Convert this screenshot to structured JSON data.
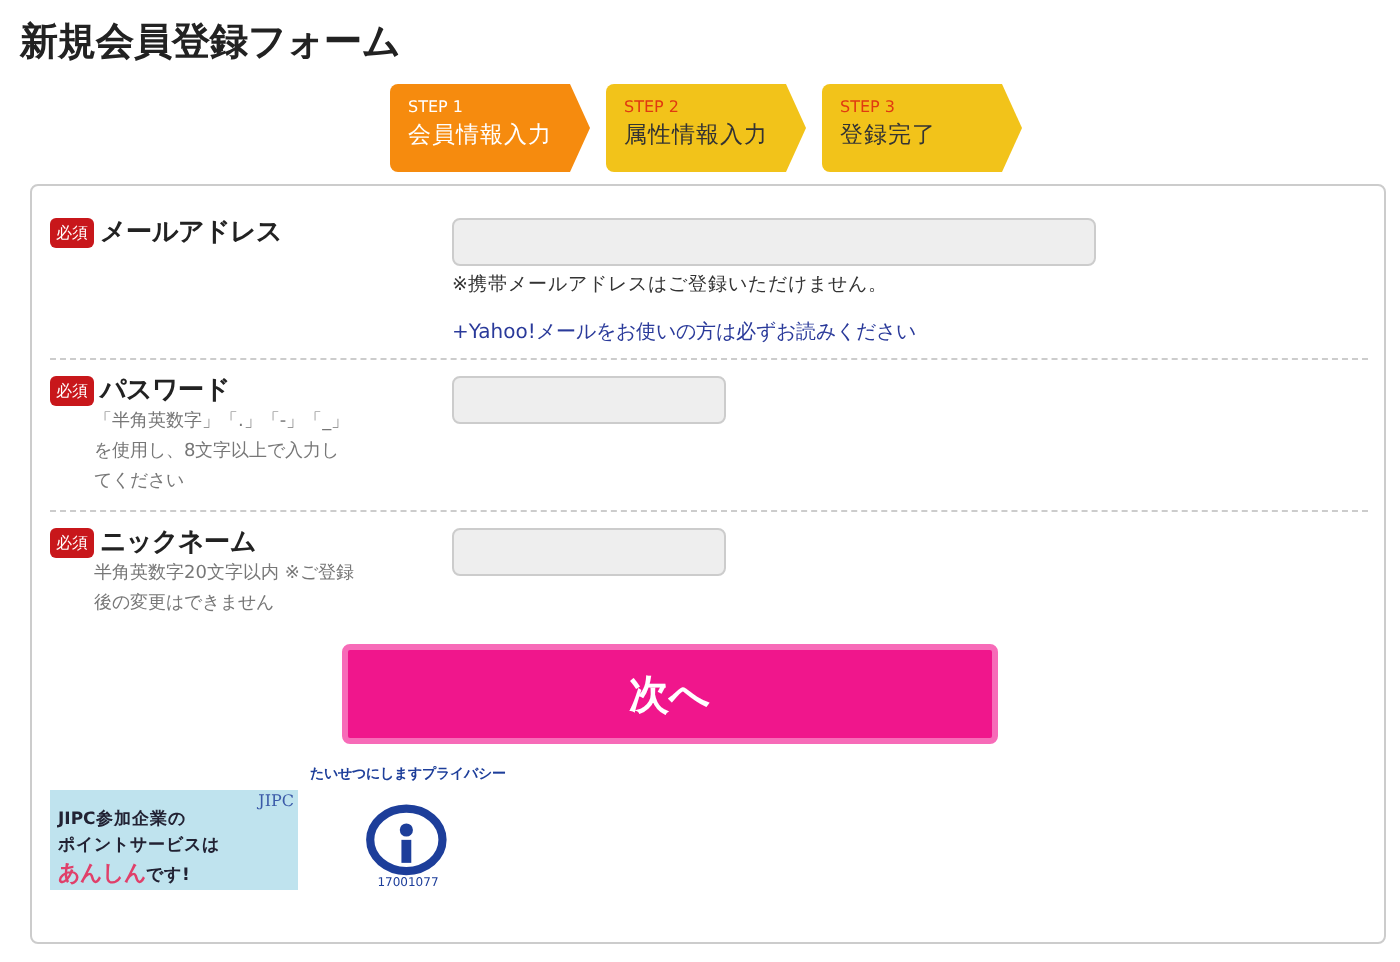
{
  "title": "新規会員登録フォーム",
  "steps": [
    {
      "step": "STEP 1",
      "label": "会員情報入力",
      "selected": true
    },
    {
      "step": "STEP 2",
      "label": "属性情報入力",
      "selected": false
    },
    {
      "step": "STEP 3",
      "label": "登録完了",
      "selected": false
    }
  ],
  "fields": [
    {
      "badge": "必須",
      "label": "メールアドレス",
      "kind": "wide",
      "notes": [
        "※携帯メールアドレスはご登録いただけません。"
      ],
      "link": "+Yahoo!メールをお使いの方は必ずお読みください"
    },
    {
      "badge": "必須",
      "label": "パスワード",
      "hint": "「半角英数字」「.」「-」「_」を使用し、8文字以上で入力してください",
      "kind": "short"
    },
    {
      "badge": "必須",
      "label": "ニックネーム",
      "hint": "半角英数字20文字以内 ※ご登録後の変更はできません",
      "kind": "short"
    }
  ],
  "submit": "次へ",
  "jipc_banner": {
    "logo": "JIPC",
    "lines": [
      "JIPC参加企業の",
      "ポイントサービスは"
    ],
    "highlight": "あんしん",
    "tail": "です!"
  },
  "privacy_mark": {
    "arc": "たいせつにしますプライバシー",
    "number": "17001077"
  }
}
